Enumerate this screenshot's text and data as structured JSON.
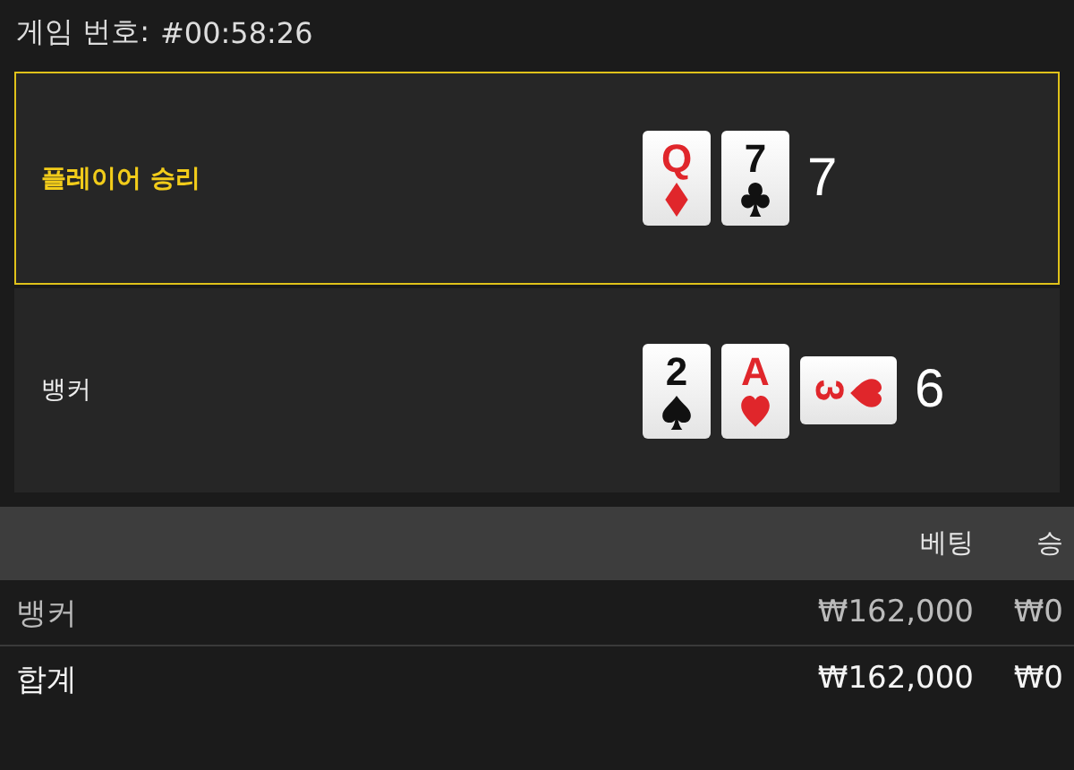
{
  "header": {
    "label": "게임 번호:",
    "game_number": "#00:58:26"
  },
  "hands": [
    {
      "label": "플레이어 승리",
      "winner": true,
      "total": "7",
      "cards": [
        {
          "rank": "Q",
          "kind": "diamonds",
          "rotated": false
        },
        {
          "rank": "7",
          "kind": "clubs",
          "rotated": false
        }
      ]
    },
    {
      "label": "뱅커",
      "winner": false,
      "total": "6",
      "cards": [
        {
          "rank": "2",
          "kind": "spades",
          "rotated": false
        },
        {
          "rank": "A",
          "kind": "hearts",
          "rotated": false
        },
        {
          "rank": "3",
          "kind": "hearts",
          "rotated": true
        }
      ]
    }
  ],
  "table": {
    "columns": [
      "베팅",
      "승"
    ],
    "rows": [
      {
        "name": "뱅커",
        "bet": "₩162,000",
        "win": "₩0",
        "kind": "bet"
      },
      {
        "name": "합계",
        "bet": "₩162,000",
        "win": "₩0",
        "kind": "total"
      }
    ]
  }
}
